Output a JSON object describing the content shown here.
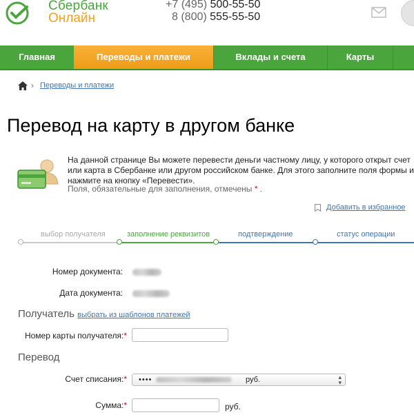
{
  "header": {
    "logo_line1": "Сбербанк",
    "logo_line2": "Онлайн",
    "phone1_prefix": "+7 (495) ",
    "phone1_number": "500-55-50",
    "phone2_prefix": "8 (800) ",
    "phone2_number": "555-55-50"
  },
  "nav": {
    "items": [
      {
        "label": "Главная"
      },
      {
        "label": "Переводы и платежи"
      },
      {
        "label": "Вклады и счета"
      },
      {
        "label": "Карты"
      }
    ]
  },
  "breadcrumb": {
    "link": "Переводы и платежи"
  },
  "page_title": "Перевод на карту в другом банке",
  "intro": {
    "text": "На данной странице Вы можете перевести деньги частному лицу, у которого открыт счет или карта в Сбербанке или другом российском банке. Для этого заполните поля формы и нажмите на кнопку «Перевести».",
    "required_note": "Поля, обязательные для заполнения, отмечены",
    "required_star": "*",
    "required_tail": "."
  },
  "favorites_link": "Добавить в избранное",
  "steps": [
    {
      "label": "выбор получателя",
      "state": "done"
    },
    {
      "label": "заполнение реквизитов",
      "state": "active"
    },
    {
      "label": "подтверждение",
      "state": "todo"
    },
    {
      "label": "статус операции",
      "state": "todo"
    }
  ],
  "colors": {
    "brand_green": "#4aa53c",
    "brand_orange": "#f5a623",
    "link_blue": "#3f74b0",
    "required_red": "#d0021b"
  },
  "form": {
    "doc_number_label": "Номер документа:",
    "doc_date_label": "Дата документа:",
    "recipient_section": "Получатель",
    "templates_link": "выбрать из шаблонов платежей",
    "card_number_label": "Номер карты получателя:",
    "transfer_section": "Перевод",
    "account_label": "Счет списания:",
    "account_value_prefix": "••••",
    "account_currency": "руб.",
    "amount_label": "Сумма:",
    "amount_currency": "руб.",
    "required_star": "*"
  }
}
